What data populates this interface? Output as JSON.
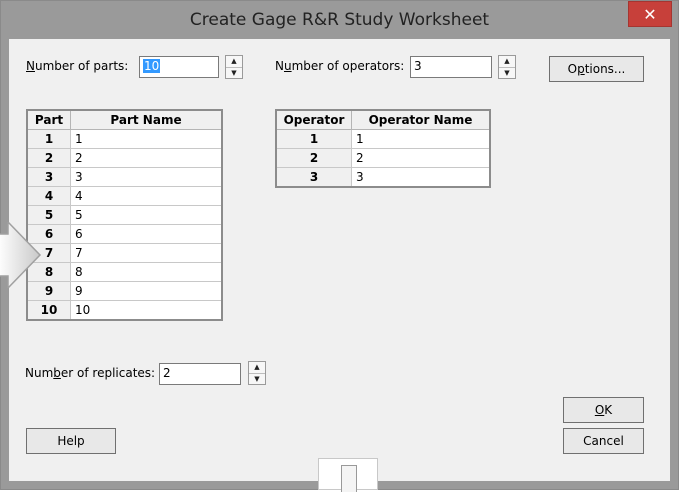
{
  "window": {
    "title": "Create Gage R&R Study Worksheet",
    "close_glyph": "✕"
  },
  "parts": {
    "label_pre": "",
    "label_u": "N",
    "label_post": "umber of parts:",
    "value": "10"
  },
  "operators": {
    "label_pre": "N",
    "label_u": "u",
    "label_post": "mber of operators:",
    "value": "3"
  },
  "replicates": {
    "label_pre": "Num",
    "label_u": "b",
    "label_post": "er of replicates:",
    "value": "2"
  },
  "spinner": {
    "up": "▲",
    "down": "▼"
  },
  "buttons": {
    "options_pre": "O",
    "options_u": "p",
    "options_post": "tions...",
    "ok_u": "O",
    "ok_post": "K",
    "cancel": "Cancel",
    "help": "Help"
  },
  "part_table": {
    "headers": [
      "Part",
      "Part Name"
    ],
    "rows": [
      {
        "n": "1",
        "name": "1"
      },
      {
        "n": "2",
        "name": "2"
      },
      {
        "n": "3",
        "name": "3"
      },
      {
        "n": "4",
        "name": "4"
      },
      {
        "n": "5",
        "name": "5"
      },
      {
        "n": "6",
        "name": "6"
      },
      {
        "n": "7",
        "name": "7"
      },
      {
        "n": "8",
        "name": "8"
      },
      {
        "n": "9",
        "name": "9"
      },
      {
        "n": "10",
        "name": "10"
      }
    ]
  },
  "operator_table": {
    "headers": [
      "Operator",
      "Operator Name"
    ],
    "rows": [
      {
        "n": "1",
        "name": "1"
      },
      {
        "n": "2",
        "name": "2"
      },
      {
        "n": "3",
        "name": "3"
      }
    ]
  },
  "colors": {
    "title_bar": "#9a9a9a",
    "close": "#c7403a",
    "selection": "#3399ff",
    "dialog_bg": "#f0f0f0"
  }
}
